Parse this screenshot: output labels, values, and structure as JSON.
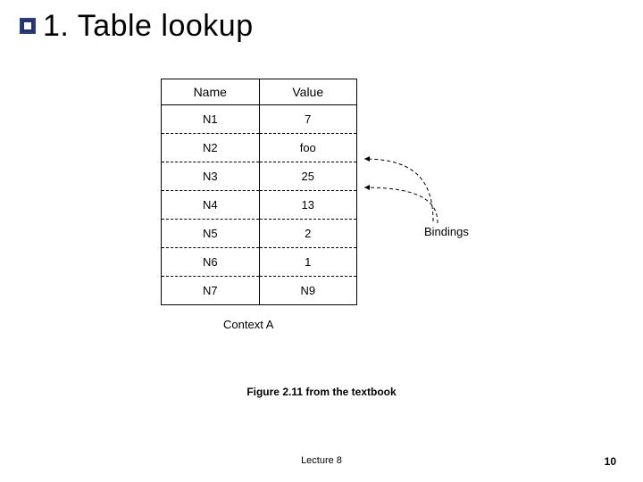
{
  "title": "1. Table lookup",
  "table": {
    "headers": {
      "name": "Name",
      "value": "Value"
    },
    "rows": [
      {
        "name": "N1",
        "value": "7"
      },
      {
        "name": "N2",
        "value": "foo"
      },
      {
        "name": "N3",
        "value": "25"
      },
      {
        "name": "N4",
        "value": "13"
      },
      {
        "name": "N5",
        "value": "2"
      },
      {
        "name": "N6",
        "value": "1"
      },
      {
        "name": "N7",
        "value": "N9"
      }
    ],
    "context_label": "Context A",
    "bindings_label": "Bindings"
  },
  "figure_caption": "Figure 2.11 from the textbook",
  "footer": {
    "lecture": "Lecture 8",
    "page": "10"
  }
}
